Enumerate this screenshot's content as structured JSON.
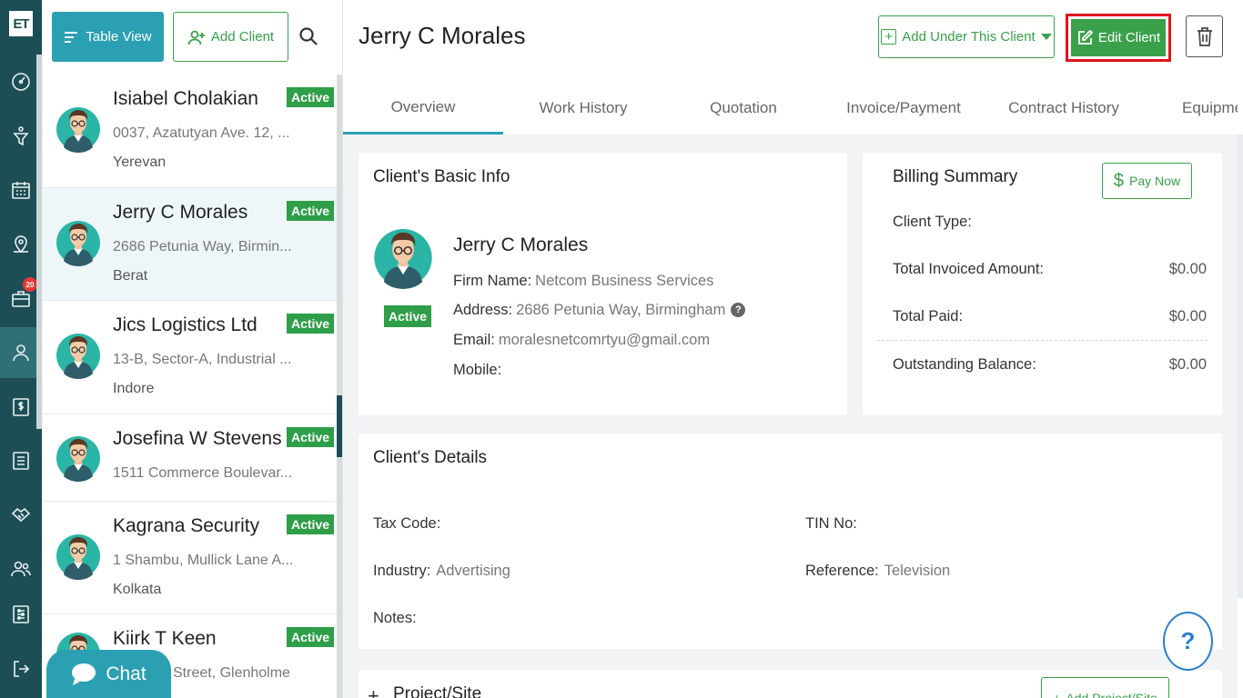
{
  "rail": {
    "logo": "ET",
    "items": [
      {
        "icon": "dashboard-gauge-icon"
      },
      {
        "icon": "funnel-icon"
      },
      {
        "icon": "calendar-icon"
      },
      {
        "icon": "map-pin-icon"
      },
      {
        "icon": "briefcase-icon",
        "badge": "20"
      },
      {
        "icon": "user-icon",
        "active": true
      },
      {
        "icon": "dollar-document-icon"
      },
      {
        "icon": "checklist-icon"
      },
      {
        "icon": "handshake-icon"
      },
      {
        "icon": "users-icon"
      },
      {
        "icon": "sliders-icon"
      },
      {
        "icon": "logout-icon"
      }
    ]
  },
  "list": {
    "table_view_label": "Table View",
    "add_client_label": "Add Client",
    "clients": [
      {
        "name": "Isiabel  Cholakian",
        "addr1": "0037, Azatutyan Ave. 12, ...",
        "addr2": "Yerevan",
        "status": "Active"
      },
      {
        "name": "Jerry C Morales",
        "addr1": "2686 Petunia Way, Birmin...",
        "addr2": "Berat",
        "status": "Active"
      },
      {
        "name": "Jics Logistics Ltd",
        "addr1": "13-B, Sector-A, Industrial ...",
        "addr2": "Indore",
        "status": "Active"
      },
      {
        "name": "Josefina W Stevens",
        "addr1": "1511 Commerce Boulevar...",
        "addr2": "",
        "status": "Active"
      },
      {
        "name": "Kagrana Security",
        "addr1": "1 Shambu, Mullick Lane A...",
        "addr2": "Kolkata",
        "status": "Active"
      },
      {
        "name": "Kiirk T Keen",
        "addr1": "Street, Glenholme",
        "addr2": "",
        "status": "Active"
      }
    ]
  },
  "chat": {
    "label": "Chat"
  },
  "header": {
    "title": "Jerry C Morales",
    "add_under_label": "Add Under This Client",
    "edit_label": "Edit Client"
  },
  "tabs": [
    "Overview",
    "Work History",
    "Quotation",
    "Invoice/Payment",
    "Contract History",
    "Equipme"
  ],
  "basic_info": {
    "title": "Client's Basic Info",
    "name": "Jerry C Morales",
    "status": "Active",
    "firm_label": "Firm Name:",
    "firm_value": "Netcom Business Services",
    "address_label": "Address:",
    "address_value": "2686 Petunia Way, Birmingham",
    "email_label": "Email:",
    "email_value": "moralesnetcomrtyu@gmail.com",
    "mobile_label": "Mobile:",
    "mobile_value": ""
  },
  "billing": {
    "title": "Billing Summary",
    "pay_now_label": "Pay Now",
    "rows": [
      {
        "label": "Client Type:",
        "value": ""
      },
      {
        "label": "Total Invoiced Amount:",
        "value": "$0.00"
      },
      {
        "label": "Total Paid:",
        "value": "$0.00"
      },
      {
        "label": "Outstanding Balance:",
        "value": "$0.00"
      }
    ]
  },
  "details": {
    "title": "Client's Details",
    "tax_label": "Tax Code:",
    "tax_value": "",
    "tin_label": "TIN No:",
    "tin_value": "",
    "industry_label": "Industry:",
    "industry_value": "Advertising",
    "reference_label": "Reference:",
    "reference_value": "Television",
    "notes_label": "Notes:",
    "notes_value": ""
  },
  "project": {
    "title": "Project/Site",
    "add_label": "Add Project/Site"
  },
  "help": {
    "label": "?"
  }
}
